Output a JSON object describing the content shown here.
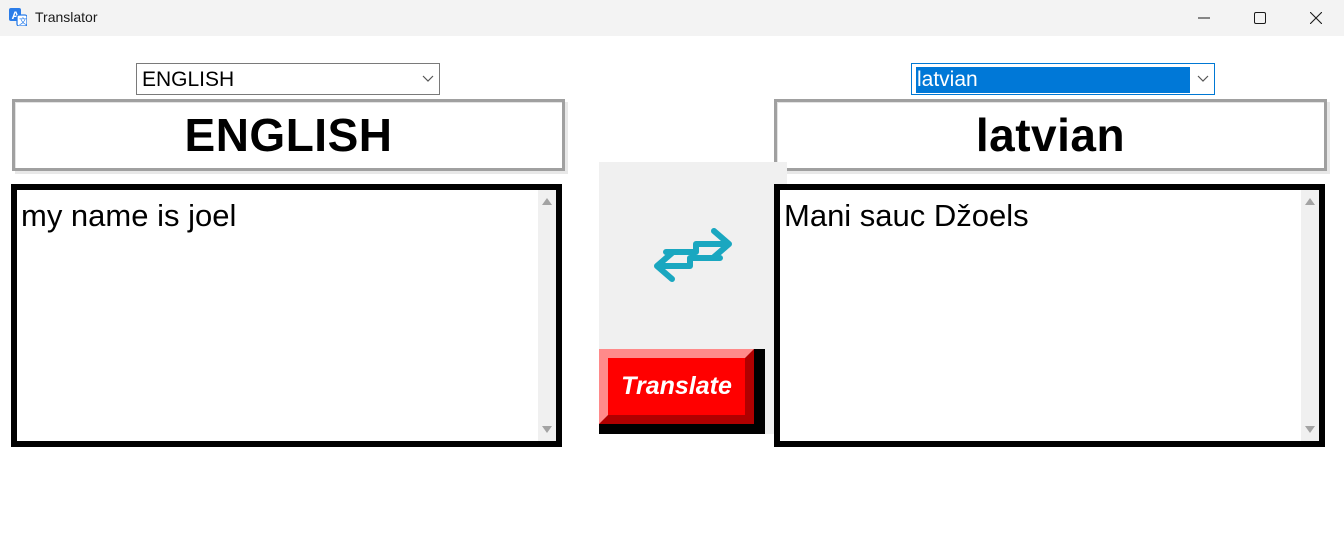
{
  "window": {
    "title": "Translator",
    "icon": "translate-app-icon",
    "controls": [
      "minimize-icon",
      "maximize-icon",
      "close-icon"
    ]
  },
  "source": {
    "dropdown_value": "ENGLISH",
    "header": "ENGLISH",
    "text": "my name is joel"
  },
  "target": {
    "dropdown_value": "latvian",
    "header": "latvian",
    "text": "Mani sauc Džoels"
  },
  "actions": {
    "swap_icon": "swap-arrows-icon",
    "translate_label": "Translate"
  },
  "colors": {
    "accent": "#0078d7",
    "swap_icon": "#1aa7c0",
    "translate_button": "#ff0000"
  }
}
